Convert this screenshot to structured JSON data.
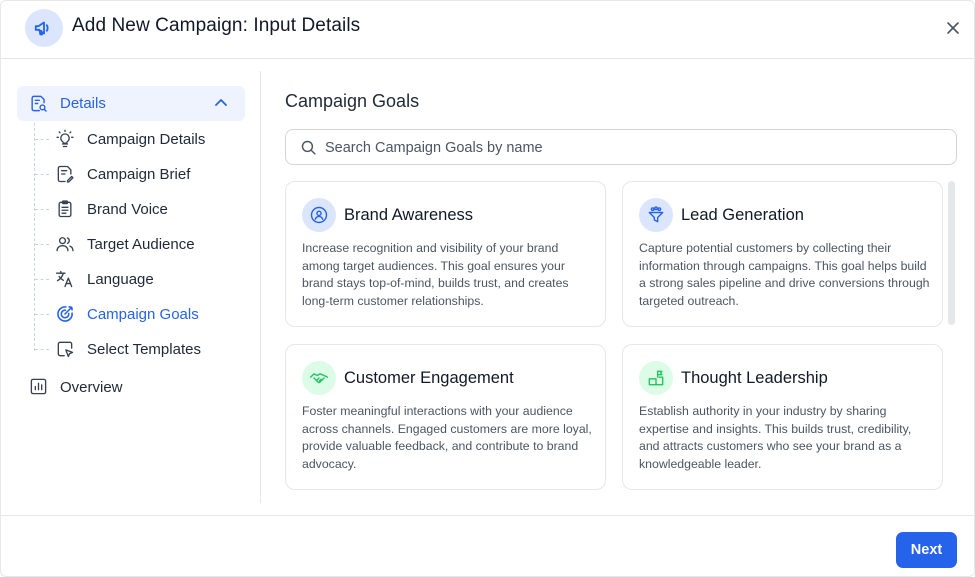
{
  "header": {
    "title": "Add New Campaign: Input Details",
    "icon": "megaphone-icon",
    "close_icon": "close-icon"
  },
  "sidebar": {
    "parent": {
      "label": "Details",
      "icon": "document-search-icon",
      "expanded": true
    },
    "items": [
      {
        "label": "Campaign Details",
        "icon": "lightbulb-icon",
        "active": false
      },
      {
        "label": "Campaign Brief",
        "icon": "document-edit-icon",
        "active": false
      },
      {
        "label": "Brand Voice",
        "icon": "clipboard-icon",
        "active": false
      },
      {
        "label": "Target Audience",
        "icon": "users-icon",
        "active": false
      },
      {
        "label": "Language",
        "icon": "translate-icon",
        "active": false
      },
      {
        "label": "Campaign Goals",
        "icon": "target-icon",
        "active": true
      },
      {
        "label": "Select Templates",
        "icon": "template-cursor-icon",
        "active": false
      }
    ],
    "overview": {
      "label": "Overview",
      "icon": "bar-chart-icon"
    }
  },
  "main": {
    "title": "Campaign Goals",
    "search": {
      "placeholder": "Search Campaign Goals by name",
      "value": ""
    },
    "cards": [
      {
        "title": "Brand Awareness",
        "icon": "awareness-icon",
        "desc": "Increase recognition and visibility of your brand among target audiences. This goal ensures your brand stays top-of-mind, builds trust, and creates long-term customer relationships."
      },
      {
        "title": "Lead Generation",
        "icon": "funnel-icon",
        "desc": "Capture potential customers by collecting their information through campaigns. This goal helps build a strong sales pipeline and drive conversions through targeted outreach."
      },
      {
        "title": "Customer Engagement",
        "icon": "handshake-icon",
        "desc": "Foster meaningful interactions with your audience across channels. Engaged customers are more loyal, provide valuable feedback, and contribute to brand advocacy."
      },
      {
        "title": "Thought Leadership",
        "icon": "podium-icon",
        "desc": "Establish authority in your industry by sharing expertise and insights. This builds trust, credibility, and attracts customers who see your brand as a knowledgeable leader."
      }
    ]
  },
  "footer": {
    "next_label": "Next"
  },
  "colors": {
    "accent": "#2563eb",
    "active_bg": "#eef3fe",
    "blue_badge": "#dbe6fd",
    "green_badge": "#dcfce7",
    "green_icon": "#22c55e"
  }
}
